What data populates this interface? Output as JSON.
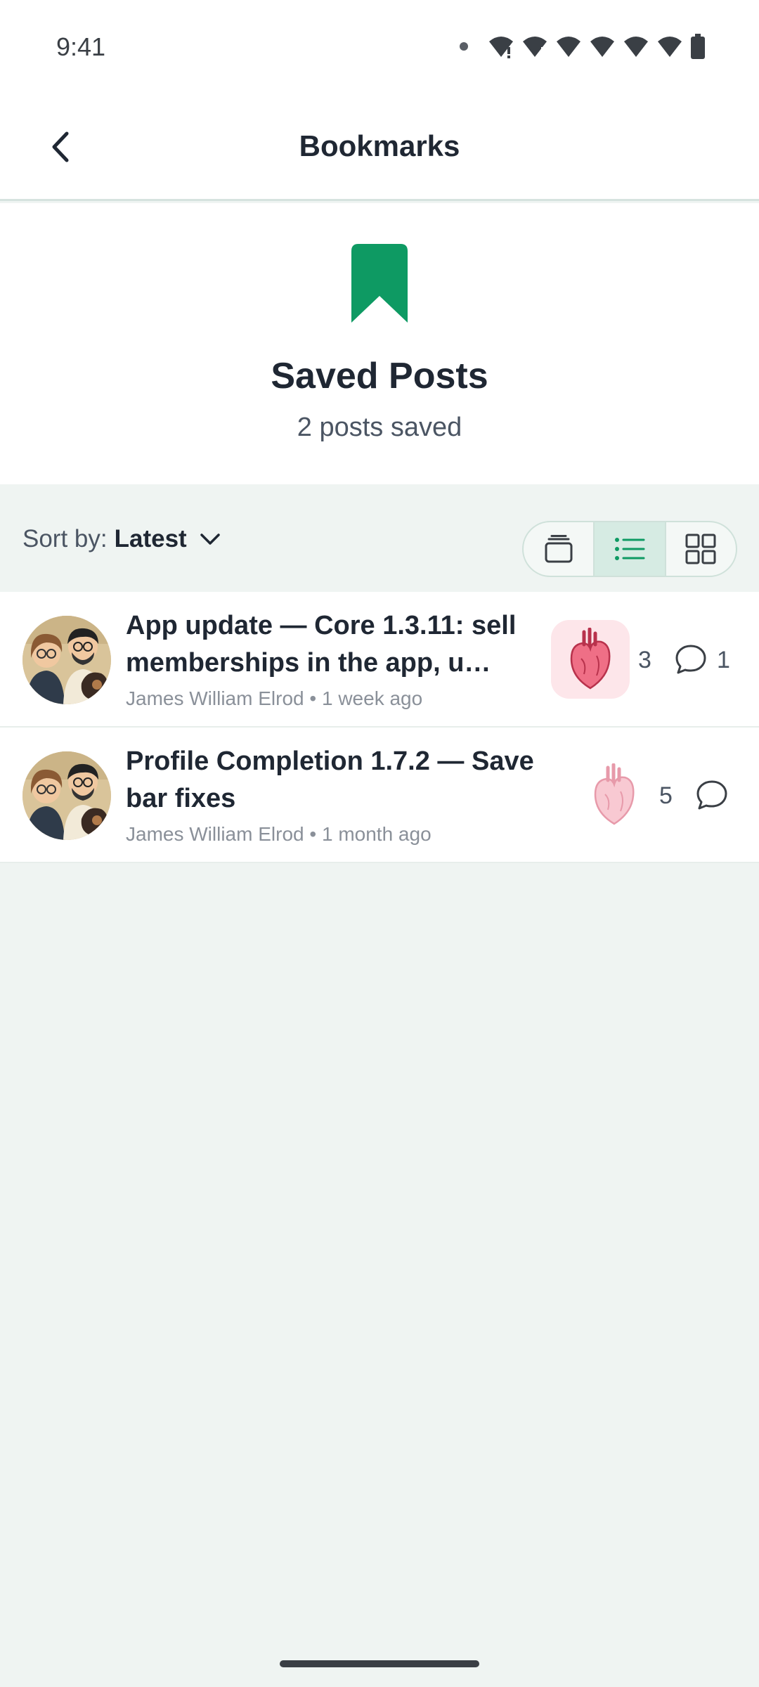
{
  "status_bar": {
    "time": "9:41"
  },
  "header": {
    "title": "Bookmarks"
  },
  "hero": {
    "title": "Saved Posts",
    "subtitle": "2 posts saved",
    "icon": "bookmark-icon",
    "accent_color": "#0e9a63"
  },
  "toolbar": {
    "sort_label": "Sort by:",
    "sort_value": "Latest",
    "views": [
      "card-view",
      "list-view",
      "grid-view"
    ],
    "active_view": "list-view"
  },
  "posts": [
    {
      "title": "App update — Core 1.3.11: sell memberships in the app, u…",
      "author": "James William Elrod",
      "time": "1 week ago",
      "separator": "•",
      "reactions": "3",
      "comments": "1",
      "reacted": true
    },
    {
      "title": "Profile Completion 1.7.2 — Save bar fixes",
      "author": "James William Elrod",
      "time": "1 month ago",
      "separator": "•",
      "reactions": "5",
      "comments": "",
      "reacted": false
    }
  ]
}
